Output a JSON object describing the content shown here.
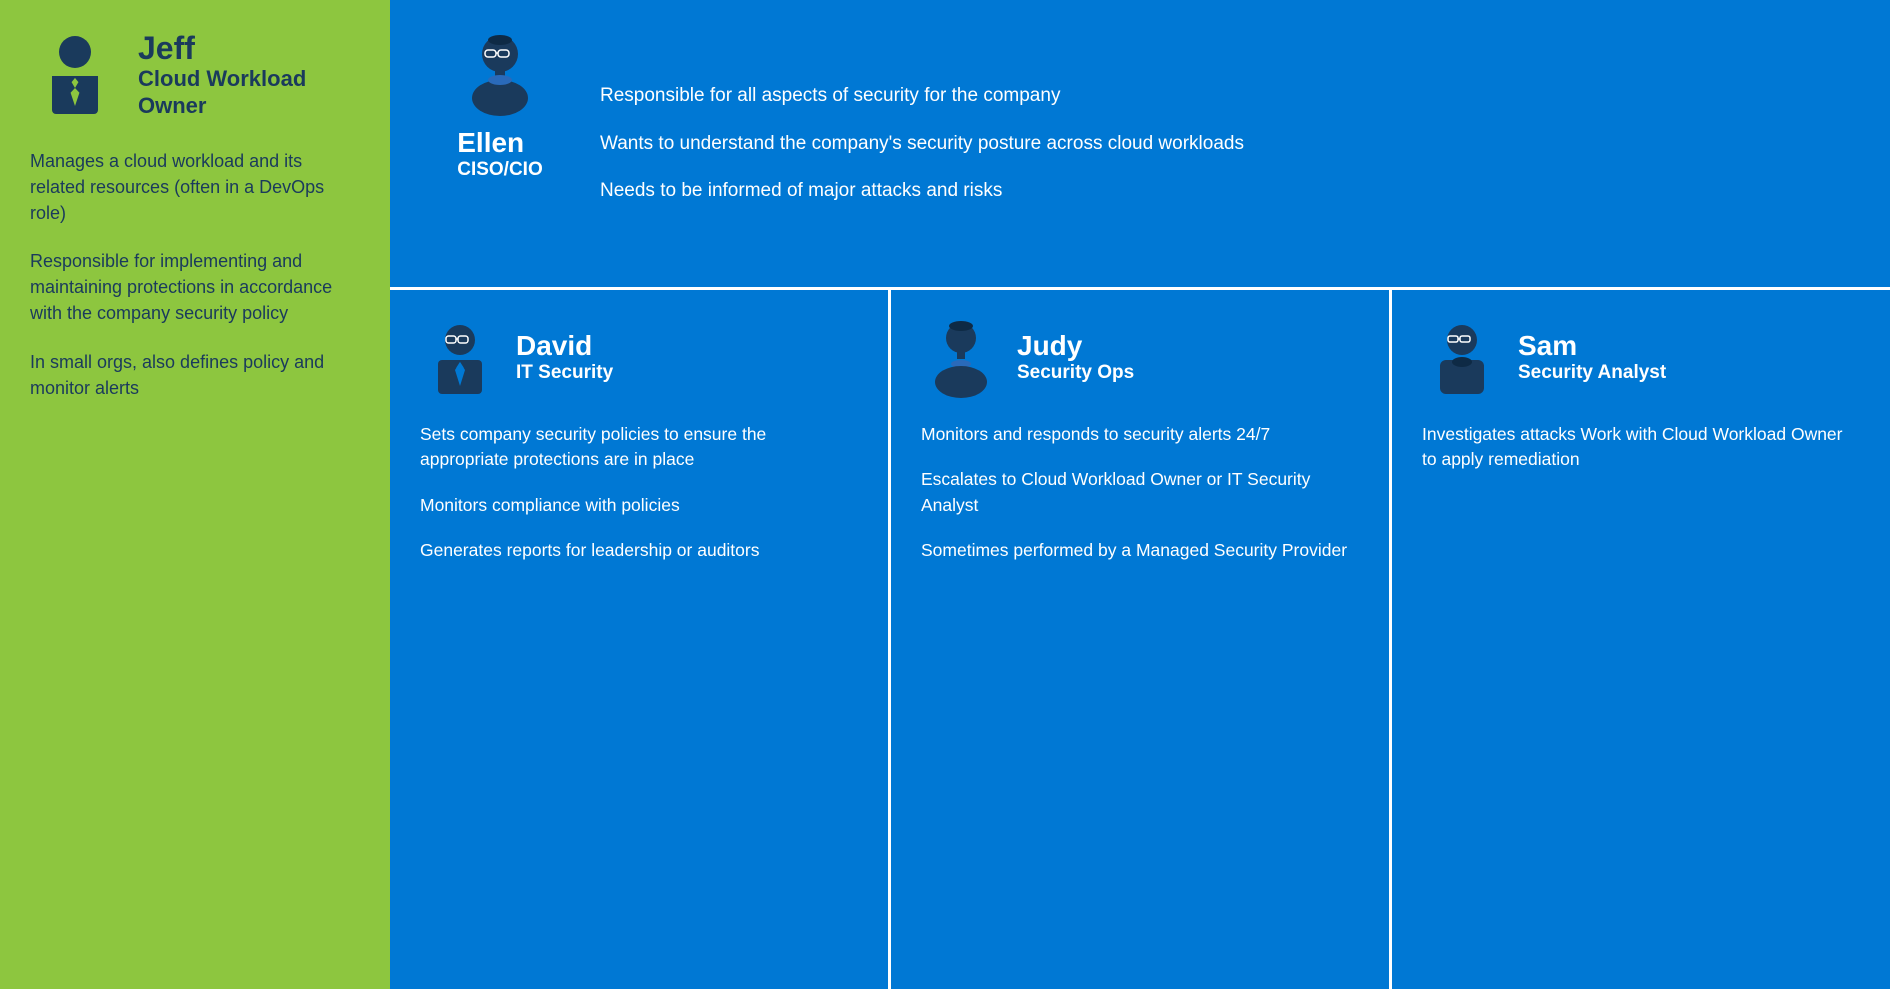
{
  "left": {
    "name": "Jeff",
    "role_line1": "Cloud Workload",
    "role_line2": "Owner",
    "desc1": "Manages a cloud workload and its related resources (often in a DevOps role)",
    "desc2": "Responsible for implementing and maintaining protections in accordance with the company security policy",
    "desc3": "In small orgs, also defines policy and monitor alerts"
  },
  "ellen": {
    "name": "Ellen",
    "role": "CISO/CIO",
    "desc1": "Responsible for all aspects of security for the company",
    "desc2": "Wants to understand the company's security posture across cloud workloads",
    "desc3": "Needs to be informed of major attacks and risks"
  },
  "david": {
    "name": "David",
    "role": "IT Security",
    "desc1": "Sets company security policies to ensure the appropriate protections are in place",
    "desc2": "Monitors compliance with policies",
    "desc3": "Generates reports for leadership or auditors"
  },
  "judy": {
    "name": "Judy",
    "role": "Security Ops",
    "desc1": "Monitors and responds to security alerts 24/7",
    "desc2": "Escalates to Cloud Workload Owner or IT Security Analyst",
    "desc3": "Sometimes performed by a Managed Security Provider"
  },
  "sam": {
    "name": "Sam",
    "role": "Security Analyst",
    "desc1": "Investigates attacks Work with Cloud Workload Owner to apply remediation",
    "desc2": "",
    "desc3": ""
  },
  "colors": {
    "green": "#8DC63F",
    "blue": "#0078D4",
    "dark_navy": "#1a3a5c"
  }
}
